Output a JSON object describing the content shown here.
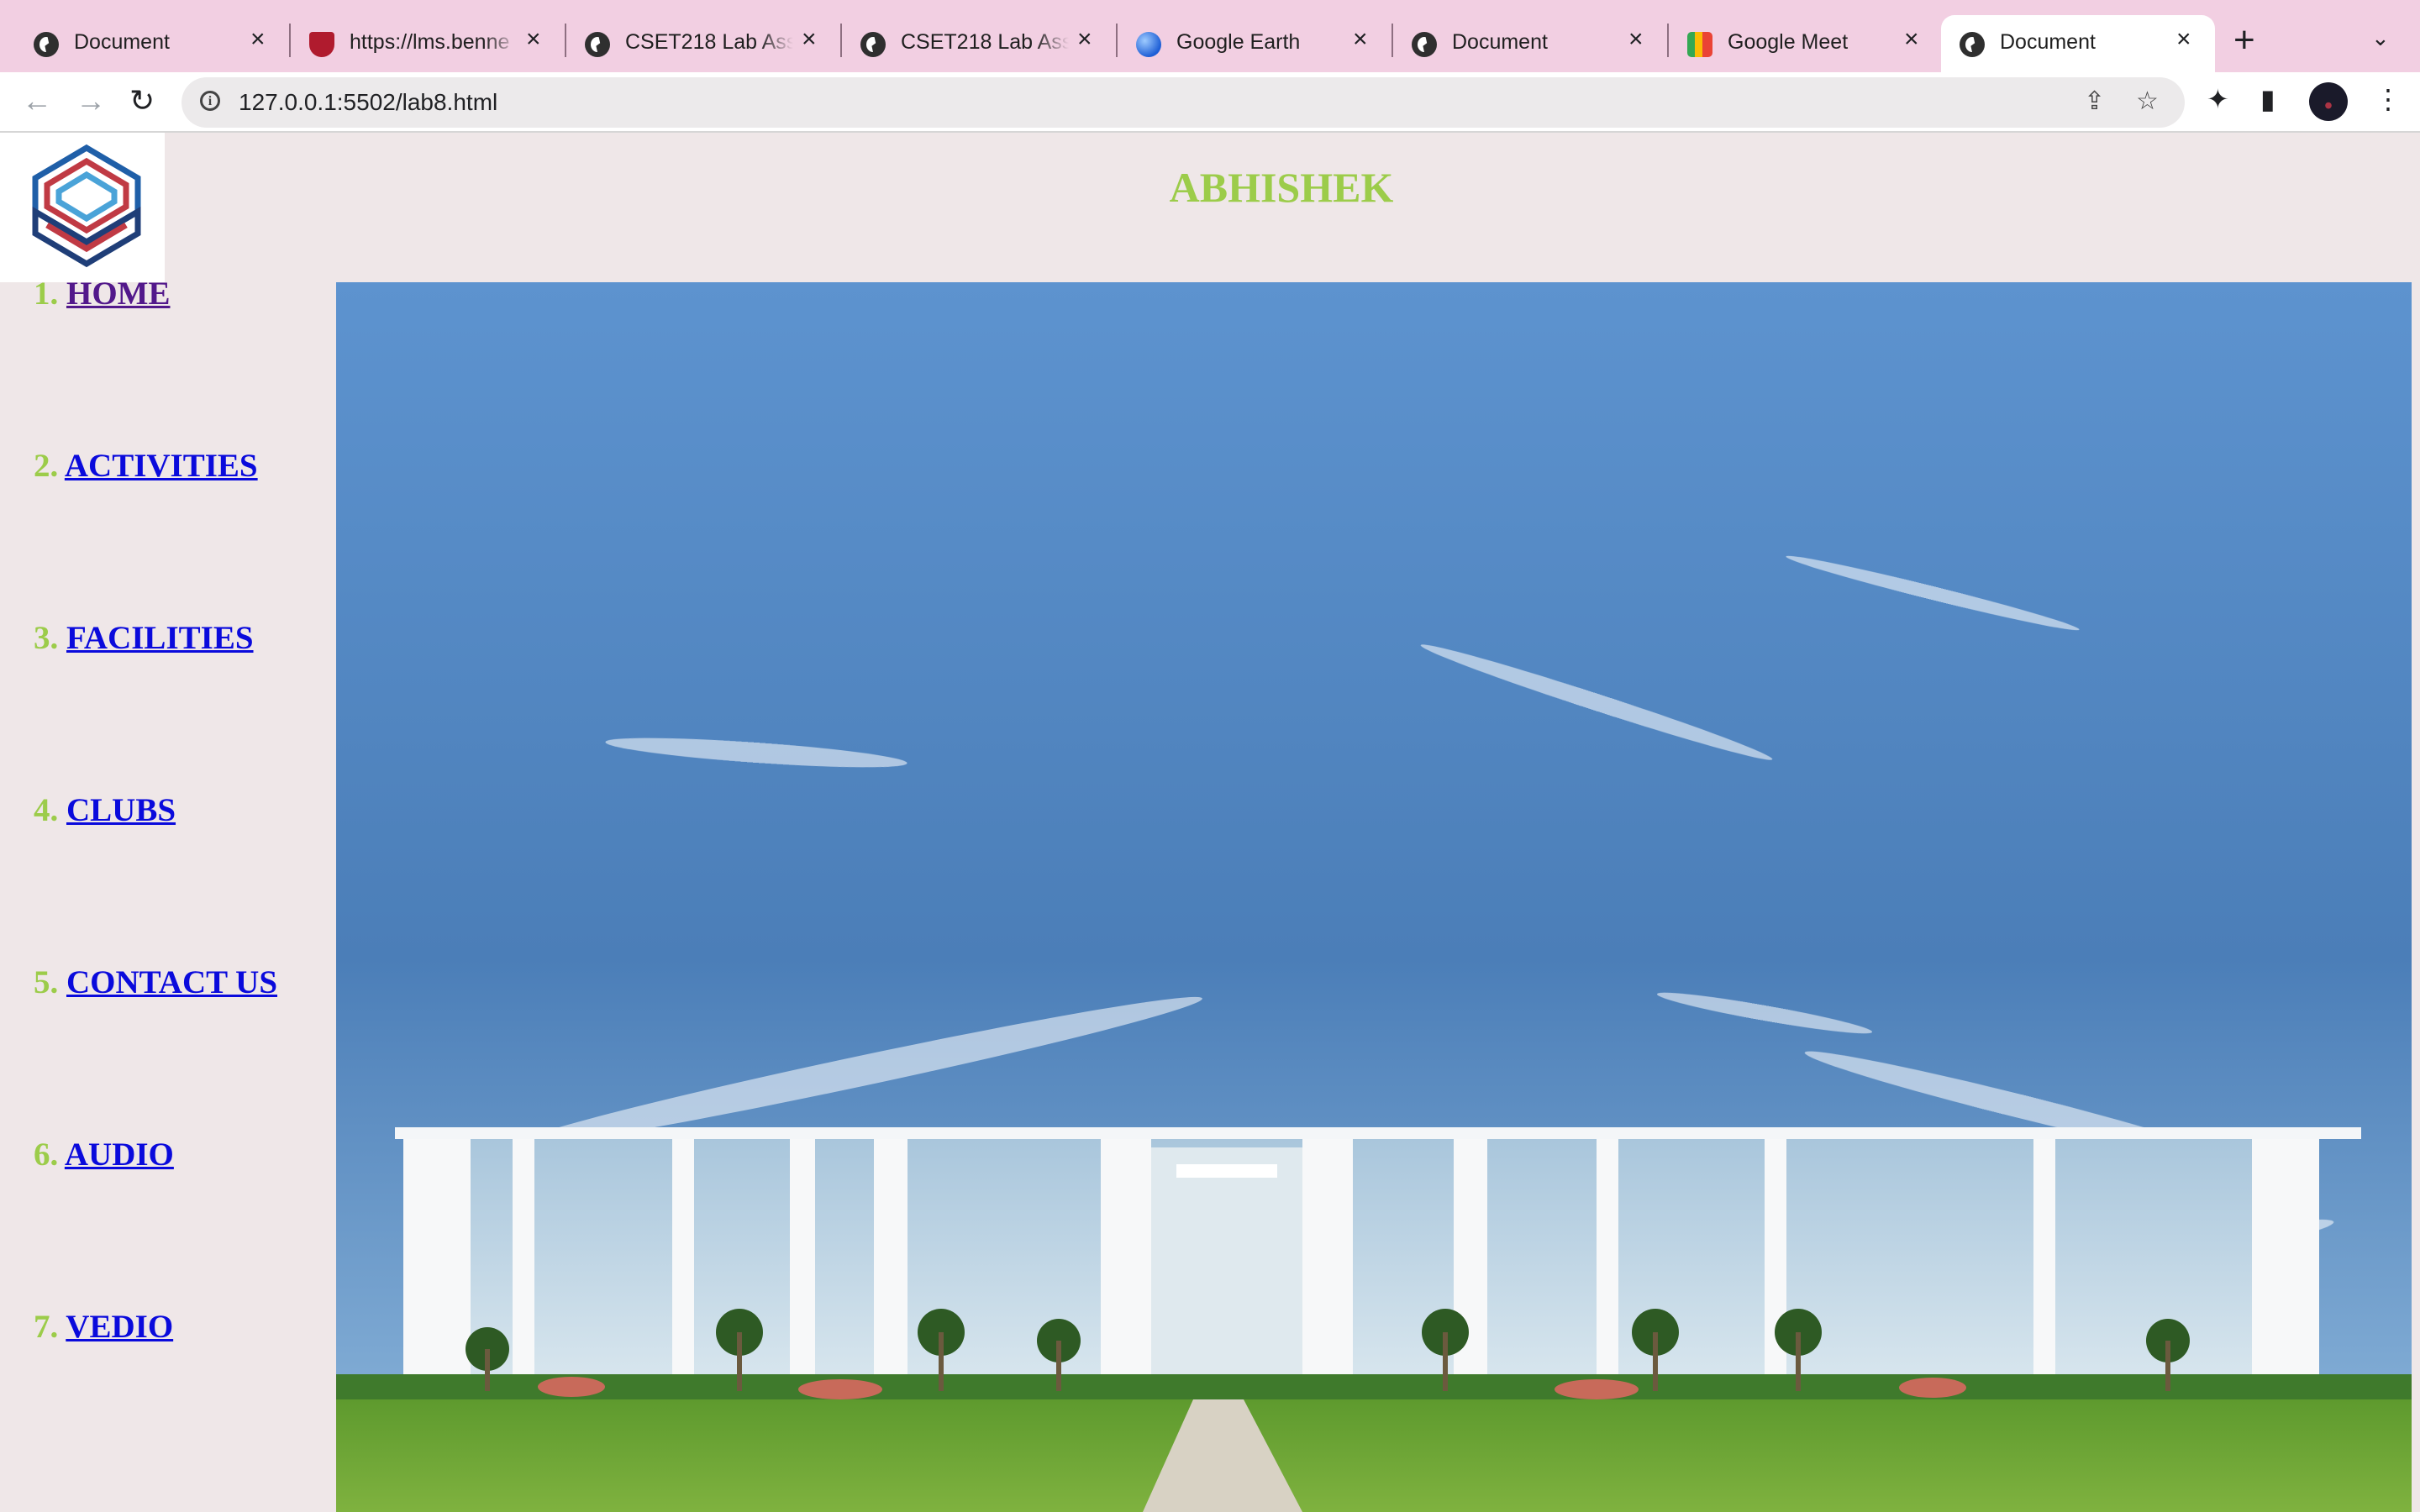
{
  "browser": {
    "tabs": [
      {
        "title": "Document",
        "icon": "globe-icon",
        "active": false
      },
      {
        "title": "https://lms.benne",
        "icon": "shield-favicon-icon",
        "active": false
      },
      {
        "title": "CSET218 Lab Ass",
        "icon": "globe-icon",
        "active": false
      },
      {
        "title": "CSET218 Lab Ass",
        "icon": "globe-icon",
        "active": false
      },
      {
        "title": "Google Earth",
        "icon": "google-earth-icon",
        "active": false
      },
      {
        "title": "Document",
        "icon": "globe-icon",
        "active": false
      },
      {
        "title": "Google Meet",
        "icon": "google-meet-icon",
        "active": false
      },
      {
        "title": "Document",
        "icon": "globe-icon",
        "active": true
      }
    ],
    "url": "127.0.0.1:5502/lab8.html",
    "colors": {
      "tabstrip": "#f2cfe2",
      "active_tab": "#ffffff"
    }
  },
  "page": {
    "title": "ABHISHEK",
    "nav": [
      {
        "num": "1.",
        "label": "HOME",
        "visited": true
      },
      {
        "num": "2.",
        "label": "ACTIVITIES",
        "visited": false
      },
      {
        "num": "3.",
        "label": "FACILITIES",
        "visited": false
      },
      {
        "num": "4.",
        "label": "CLUBS",
        "visited": false
      },
      {
        "num": "5.",
        "label": "CONTACT US",
        "visited": false
      },
      {
        "num": "6.",
        "label": "AUDIO",
        "visited": false
      },
      {
        "num": "7.",
        "label": "VEDIO",
        "visited": false
      }
    ],
    "colors": {
      "title": "#9ccc4a",
      "link": "#0a0adc",
      "visited_link": "#52188b",
      "background": "#efe7e8"
    }
  }
}
